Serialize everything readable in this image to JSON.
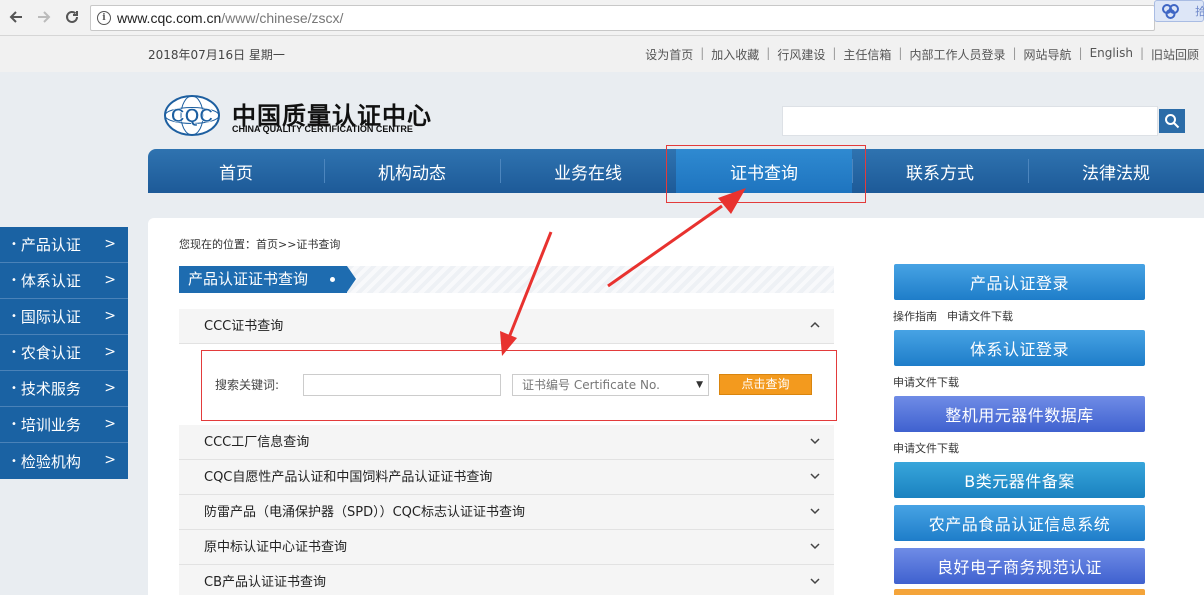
{
  "browser": {
    "back_icon": "arrow-left-icon",
    "forward_icon": "arrow-right-icon",
    "reload_icon": "reload-icon",
    "url_host": "www.cqc.com.cn",
    "url_path": "/www/chinese/zscx/",
    "extension_text": "拾"
  },
  "topbar": {
    "date": "2018年07月16日  星期一",
    "links": [
      "设为首页",
      "加入收藏",
      "行风建设",
      "主任信箱",
      "内部工作人员登录",
      "网站导航",
      "English",
      "旧站回顾"
    ]
  },
  "header": {
    "logo_text": "CQC",
    "logo_cn": "中国质量认证中心",
    "logo_en": "CHINA QUALITY CERTIFICATION CENTRE",
    "search_placeholder": ""
  },
  "nav": {
    "items": [
      "首页",
      "机构动态",
      "业务在线",
      "证书查询",
      "联系方式",
      "法律法规"
    ],
    "active_index": 3
  },
  "sidebar": {
    "items": [
      "产品认证",
      "体系认证",
      "国际认证",
      "农食认证",
      "技术服务",
      "培训业务",
      "检验机构"
    ]
  },
  "main": {
    "breadcrumb": "您现在的位置：首页>>证书查询",
    "section_title": "产品认证证书查询",
    "accordion": [
      "CCC证书查询",
      "CCC工厂信息查询",
      "CQC自愿性产品认证和中国饲料产品认证证书查询",
      "防雷产品（电涌保护器（SPD））CQC标志认证证书查询",
      "原中标认证中心证书查询",
      "CB产品认证证书查询"
    ],
    "search_form": {
      "keyword_label": "搜索关键词:",
      "keyword_value": "",
      "select_value": "证书编号 Certificate No.",
      "submit_label": "点击查询"
    }
  },
  "right": {
    "btn1": "产品认证登录",
    "btn1_links": [
      "操作指南",
      "申请文件下载"
    ],
    "btn2": "体系认证登录",
    "btn2_links": [
      "申请文件下载"
    ],
    "btn3": "整机用元器件数据库",
    "btn3_links": [
      "申请文件下载"
    ],
    "btn4": "B类元器件备案",
    "btn5": "农产品食品认证信息系统",
    "btn6": "良好电子商务规范认证"
  },
  "colors": {
    "nav_blue": "#1d5a98",
    "active_blue": "#1e74bf",
    "sidebar_blue": "#1a62a3",
    "orange": "#f39a1e",
    "annotation_red": "#e33b3b"
  }
}
